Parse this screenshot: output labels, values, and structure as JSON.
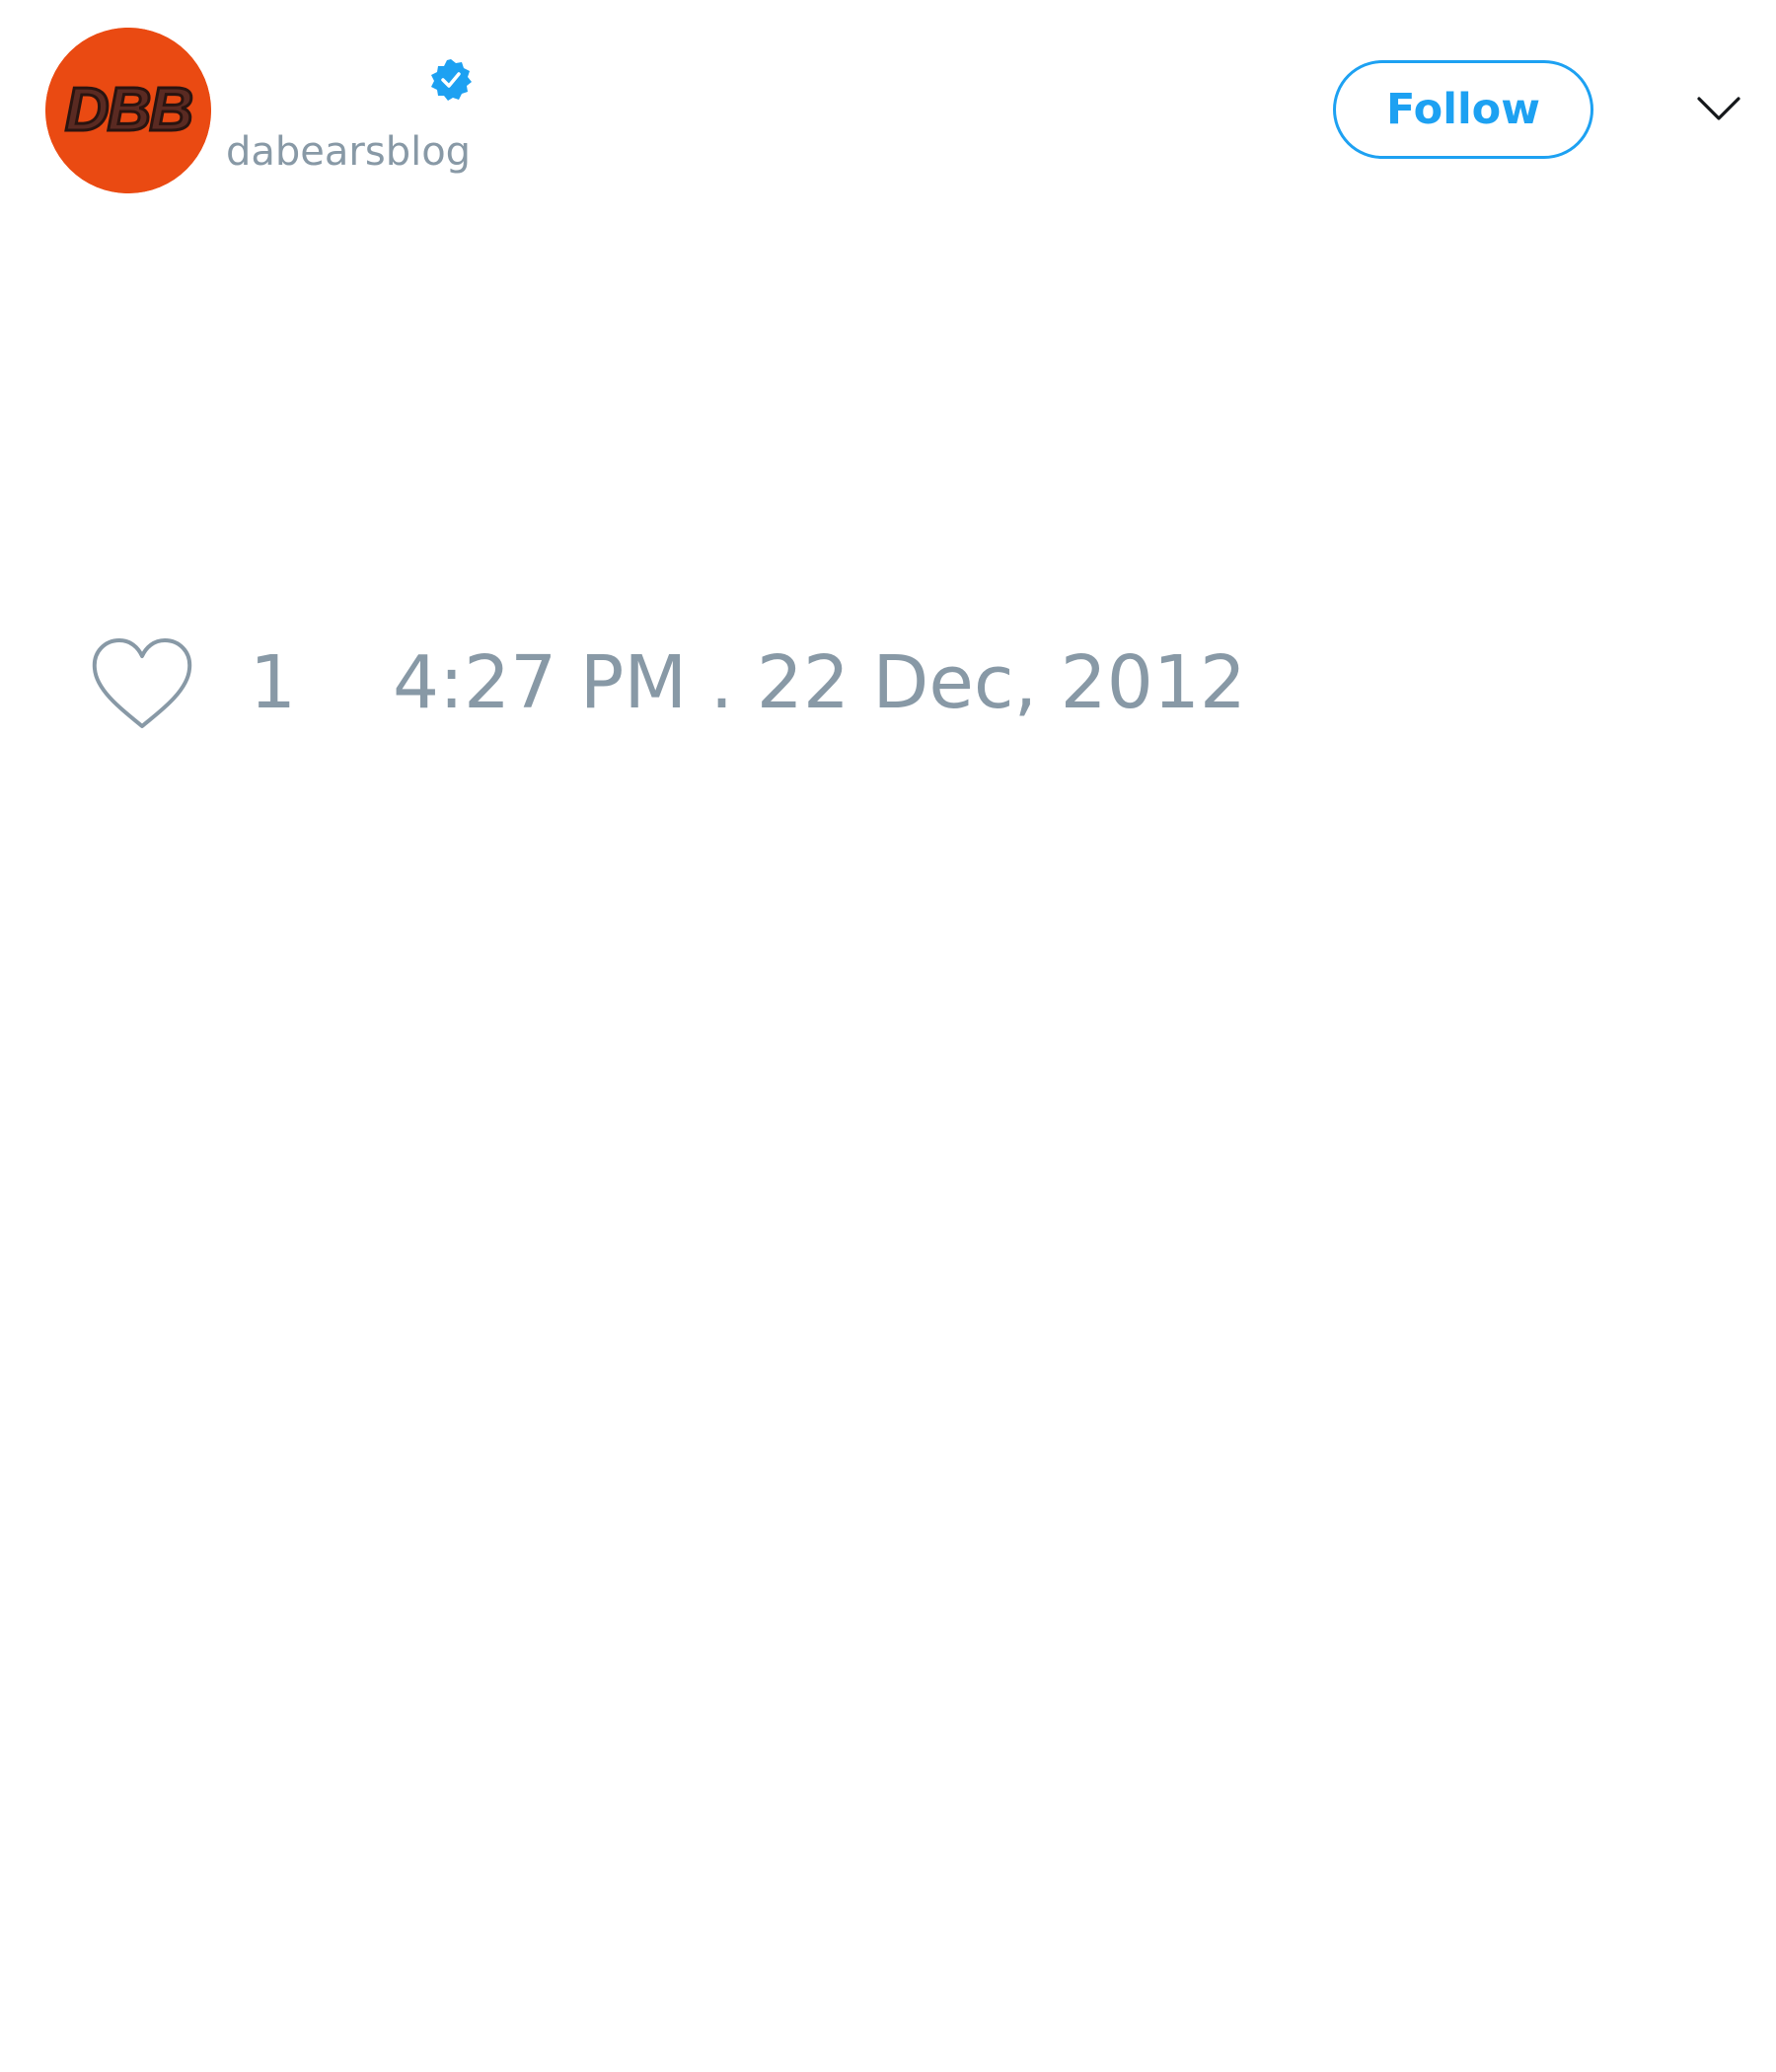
{
  "tweet": {
    "author": {
      "handle": "dabearsblog",
      "avatar_text": "DBB",
      "avatar_color": "#ea4a12",
      "verified": true,
      "verified_icon": "verified-badge-icon"
    },
    "follow_label": "Follow",
    "menu_icon": "chevron-down-icon",
    "likes": {
      "icon": "heart-icon",
      "count": "1"
    },
    "timestamp": "4:27 PM . 22 Dec, 2012"
  },
  "colors": {
    "accent": "#1da1f2",
    "muted_text": "#8899a6",
    "avatar_bg": "#ea4a12",
    "avatar_text": "#5a2a22"
  }
}
